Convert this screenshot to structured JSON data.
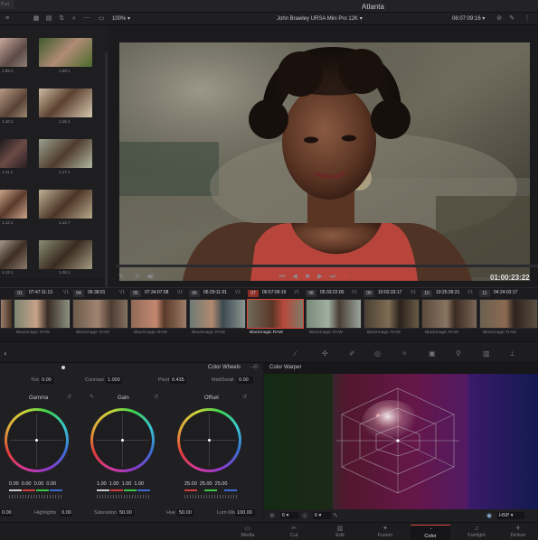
{
  "app": {
    "title": "Atlanta",
    "tab_fragment": "Pod"
  },
  "toolbar": {
    "zoom": "100%",
    "clip_name": "John Brawley URSA Mini Pro 12K",
    "timecode": "06:07:09:16"
  },
  "media_pool": {
    "labels": [
      "1.09.1",
      "1.09.1",
      "1.10.1",
      "1.16.1",
      "1.11.1",
      "1.17.1",
      "1.12.1",
      "1.12.7",
      "1.13.1",
      "1.28.1"
    ]
  },
  "viewer": {
    "timecode": "01:00:23:22"
  },
  "timeline": {
    "clips": [
      {
        "num": "01",
        "tc": "07:47:11:13",
        "track": "V1",
        "label": "Blackmagic RAW"
      },
      {
        "num": "04",
        "tc": "06:38:01",
        "track": "V1",
        "label": "Blackmagic RAW"
      },
      {
        "num": "05",
        "tc": "07:34:07:08",
        "track": "V1",
        "label": "Blackmagic RAW"
      },
      {
        "num": "06",
        "tc": "06:29:11:01",
        "track": "V1",
        "label": "Blackmagic RAW"
      },
      {
        "num": "07",
        "tc": "06:57:09:16",
        "track": "V1",
        "label": "Blackmagic RAW"
      },
      {
        "num": "08",
        "tc": "05:33:22:00",
        "track": "V1",
        "label": "Blackmagic RAW"
      },
      {
        "num": "09",
        "tc": "10:02:33:17",
        "track": "V1",
        "label": "Blackmagic RAW"
      },
      {
        "num": "10",
        "tc": "10:25:39:21",
        "track": "V1",
        "label": "Blackmagic RAW"
      },
      {
        "num": "11",
        "tc": "04:24:03:17",
        "track": "V1",
        "label": "Blackmagic RAW"
      }
    ]
  },
  "color_wheels": {
    "panel_title": "Color Wheels",
    "tint_label": "Tint",
    "tint_value": "0.00",
    "contrast_label": "Contrast",
    "contrast_value": "1.000",
    "pivot_label": "Pivot",
    "pivot_value": "0.435",
    "middetail_label": "Mid/Detail",
    "middetail_value": "0.00",
    "gamma": {
      "title": "Gamma",
      "values": [
        "0.00",
        "0.00",
        "0.00",
        "0.00"
      ]
    },
    "gain": {
      "title": "Gain",
      "values": [
        "1.00",
        "1.00",
        "1.00",
        "1.00"
      ]
    },
    "offset": {
      "title": "Offset",
      "values": [
        "25.00",
        "25.00",
        "25.00"
      ]
    },
    "bottom": {
      "left_value": "0.00",
      "highlights_label": "Highlights",
      "highlights_value": "0.00",
      "saturation_label": "Saturation",
      "saturation_value": "50.00",
      "hue_label": "Hue",
      "hue_value": "50.00",
      "lummix_label": "Lum Mix",
      "lummix_value": "100.00"
    }
  },
  "color_warper": {
    "title": "Color Warper",
    "field_a": "6",
    "field_b": "6",
    "mode": "HSP"
  },
  "nav": [
    {
      "icon": "media-icon",
      "label": "Media"
    },
    {
      "icon": "cut-icon",
      "label": "Cut"
    },
    {
      "icon": "edit-icon",
      "label": "Edit"
    },
    {
      "icon": "fusion-icon",
      "label": "Fusion"
    },
    {
      "icon": "color-icon",
      "label": "Color"
    },
    {
      "icon": "fairlight-icon",
      "label": "Fairlight"
    },
    {
      "icon": "deliver-icon",
      "label": "Deliver"
    }
  ],
  "colors": {
    "accent_red": "#d4483a",
    "panel_bg": "#202023"
  }
}
